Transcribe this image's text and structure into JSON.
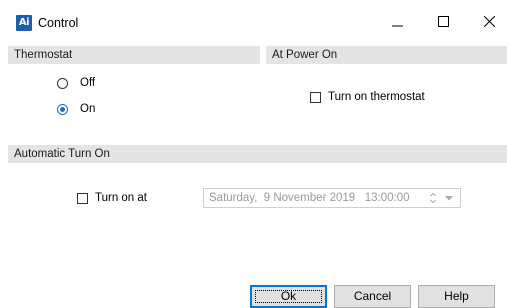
{
  "window": {
    "title": "Control",
    "app_icon_text": "Ai",
    "icons": [
      "app-icon",
      "minimize-icon",
      "maximize-icon",
      "close-icon"
    ]
  },
  "thermostat": {
    "header": "Thermostat",
    "options": [
      {
        "label": "Off",
        "checked": false
      },
      {
        "label": "On",
        "checked": true
      }
    ]
  },
  "power_on": {
    "header": "At Power On",
    "checkbox_label": "Turn on thermostat",
    "checked": false
  },
  "automatic_turn_on": {
    "header": "Automatic Turn On",
    "checkbox_label": "Turn on at",
    "checked": false,
    "datetime_value": "Saturday,  9 November 2019   13:00:00",
    "datetime_enabled": false
  },
  "buttons": {
    "ok": "Ok",
    "cancel": "Cancel",
    "help": "Help"
  },
  "colors": {
    "accent": "#1e70c8",
    "header_bg": "#e4e4e4",
    "button_bg": "#e1e1e1",
    "focus_border": "#0078d7"
  }
}
